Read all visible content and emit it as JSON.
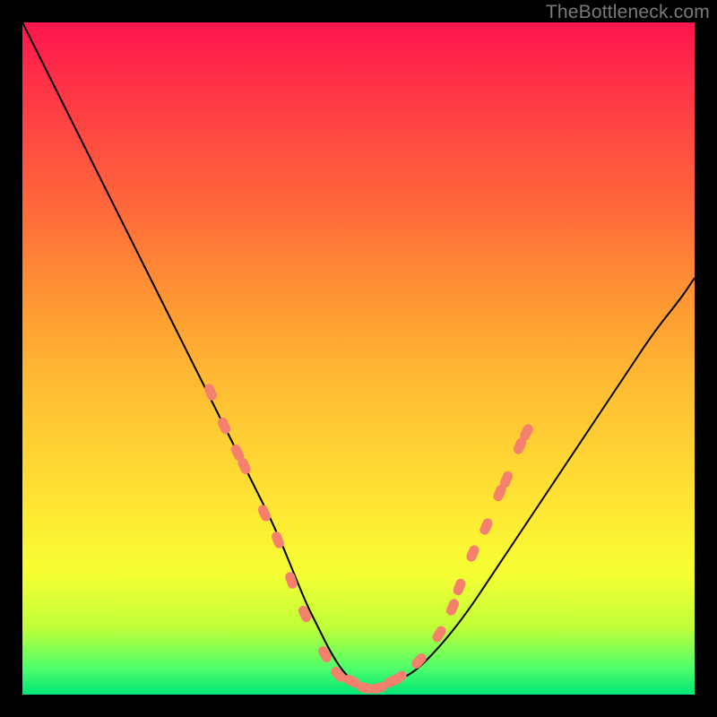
{
  "watermark": {
    "text": "TheBottleneck.com"
  },
  "chart_data": {
    "type": "line",
    "title": "",
    "xlabel": "",
    "ylabel": "",
    "xlim": [
      0,
      100
    ],
    "ylim": [
      0,
      100
    ],
    "grid": false,
    "legend": false,
    "series": [
      {
        "name": "curve",
        "x": [
          0,
          4,
          8,
          12,
          16,
          20,
          24,
          28,
          30,
          34,
          38,
          42,
          44,
          46,
          48,
          50,
          52,
          54,
          58,
          62,
          66,
          70,
          74,
          78,
          82,
          86,
          90,
          94,
          98,
          100
        ],
        "y": [
          100,
          92,
          84,
          76,
          68,
          60,
          52,
          44,
          40,
          32,
          24,
          14,
          10,
          6,
          3,
          1.5,
          1,
          1.5,
          3,
          7,
          12,
          18,
          24,
          30,
          36,
          42,
          48,
          54,
          59,
          62
        ]
      }
    ],
    "markers": [
      {
        "x": 28,
        "y": 45
      },
      {
        "x": 30,
        "y": 40
      },
      {
        "x": 32,
        "y": 36
      },
      {
        "x": 33,
        "y": 34
      },
      {
        "x": 36,
        "y": 27
      },
      {
        "x": 38,
        "y": 23
      },
      {
        "x": 40,
        "y": 17
      },
      {
        "x": 42,
        "y": 12
      },
      {
        "x": 45,
        "y": 6
      },
      {
        "x": 47,
        "y": 3
      },
      {
        "x": 49,
        "y": 2
      },
      {
        "x": 51,
        "y": 1
      },
      {
        "x": 53,
        "y": 1
      },
      {
        "x": 55,
        "y": 2
      },
      {
        "x": 56,
        "y": 2.5
      },
      {
        "x": 59,
        "y": 5
      },
      {
        "x": 62,
        "y": 9
      },
      {
        "x": 64,
        "y": 13
      },
      {
        "x": 65,
        "y": 16
      },
      {
        "x": 67,
        "y": 21
      },
      {
        "x": 69,
        "y": 25
      },
      {
        "x": 71,
        "y": 30
      },
      {
        "x": 72,
        "y": 32
      },
      {
        "x": 74,
        "y": 37
      },
      {
        "x": 75,
        "y": 39
      }
    ],
    "colors": {
      "curve": "#000000",
      "markers": "#f4806d",
      "bg_top": "#ff154d",
      "bg_bottom": "#00e676"
    }
  }
}
